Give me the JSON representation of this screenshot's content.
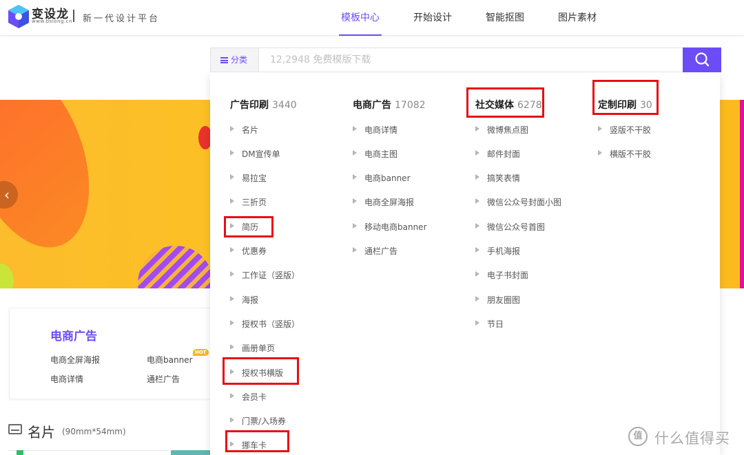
{
  "brand": {
    "name": "变设龙",
    "url": "www.bslong.cn",
    "tagline": "新一代设计平台",
    "accent_color": "#6b4cf6"
  },
  "nav": [
    {
      "label": "模板中心",
      "active": true
    },
    {
      "label": "开始设计",
      "active": false
    },
    {
      "label": "智能抠图",
      "active": false
    },
    {
      "label": "图片素材",
      "active": false
    }
  ],
  "search": {
    "category_label": "分类",
    "placeholder": "12,2948 免费模版下载",
    "button_icon": "search-icon"
  },
  "banner": {
    "prev_icon": "chevron-left-icon",
    "prev_glyph": "‹"
  },
  "card": {
    "title": "电商广告",
    "links": [
      "电商全屏海报",
      "电商banner",
      "电商详情",
      "通栏广告"
    ],
    "hot_badge": "HOT"
  },
  "section": {
    "title": "名片",
    "subtitle": "(90mm*54mm)"
  },
  "categories": [
    {
      "name": "广告印刷",
      "count": "3440",
      "items": [
        "名片",
        "DM宣传单",
        "易拉宝",
        "三折页",
        "简历",
        "优惠券",
        "工作证（竖版）",
        "海报",
        "授权书（竖版）",
        "画册单页",
        "授权书横版",
        "会员卡",
        "门票/入场券",
        "挪车卡"
      ]
    },
    {
      "name": "电商广告",
      "count": "17082",
      "items": [
        "电商详情",
        "电商主图",
        "电商banner",
        "电商全屏海报",
        "移动电商banner",
        "通栏广告"
      ]
    },
    {
      "name": "社交媒体",
      "count": "6278",
      "items": [
        "微博焦点图",
        "邮件封面",
        "搞笑表情",
        "微信公众号封面小图",
        "微信公众号首图",
        "手机海报",
        "电子书封面",
        "朋友圈图",
        "节日"
      ]
    },
    {
      "name": "定制印刷",
      "count": "30",
      "items": [
        "竖版不干胶",
        "横版不干胶"
      ]
    }
  ],
  "watermark": {
    "badge": "值",
    "text": "什么值得买"
  },
  "highlight_color": "#e60e12"
}
